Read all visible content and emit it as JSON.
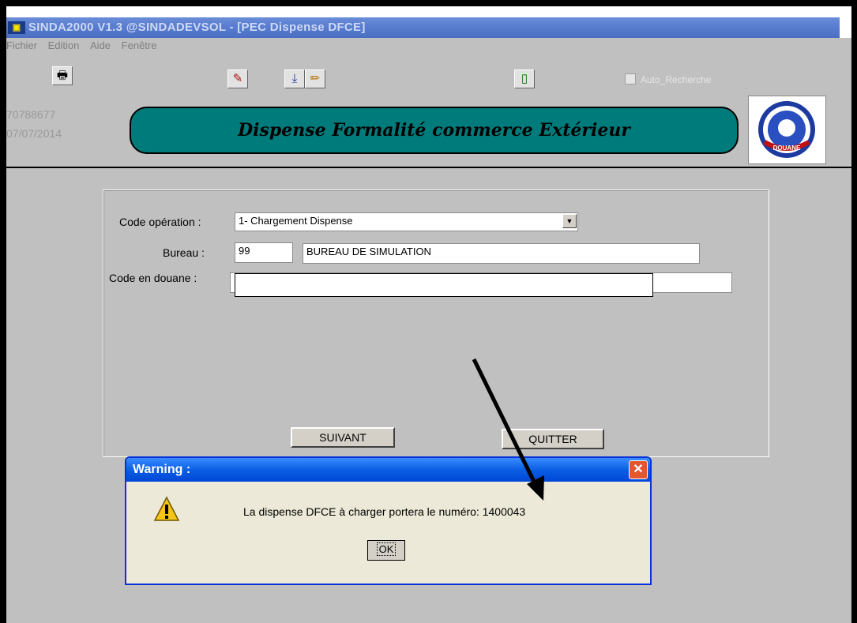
{
  "window": {
    "title": "SINDA2000 V1.3 @SINDADEVSOL - [PEC Dispense DFCE]",
    "menu": [
      "Fichier",
      "Edition",
      "Aide",
      "Fenêtre"
    ]
  },
  "toolbar": {
    "auto_recherche_label": "Auto_Recherche",
    "auto_recherche_checked": false
  },
  "info": {
    "number": "70788677",
    "date": "07/07/2014"
  },
  "banner": {
    "title": "Dispense Formalité commerce Extérieur",
    "logo_text": "DOUANE"
  },
  "form": {
    "code_operation_label": "Code opération :",
    "code_operation_value": "1- Chargement  Dispense",
    "bureau_label": "Bureau :",
    "bureau_code": "99",
    "bureau_name": "BUREAU DE SIMULATION",
    "code_douane_label": "Code en douane :",
    "code_douane_value": "",
    "next_button": "SUIVANT",
    "quit_button": "QUITTER"
  },
  "dialog": {
    "title": "Warning :",
    "message": "La dispense DFCE  à charger portera le numéro: 1400043",
    "ok_button": "OK"
  },
  "colors": {
    "banner": "#007b7b",
    "workarea": "#c0c0c0",
    "dialog_title": "#0a5fe3",
    "dialog_close": "#e4572e"
  }
}
